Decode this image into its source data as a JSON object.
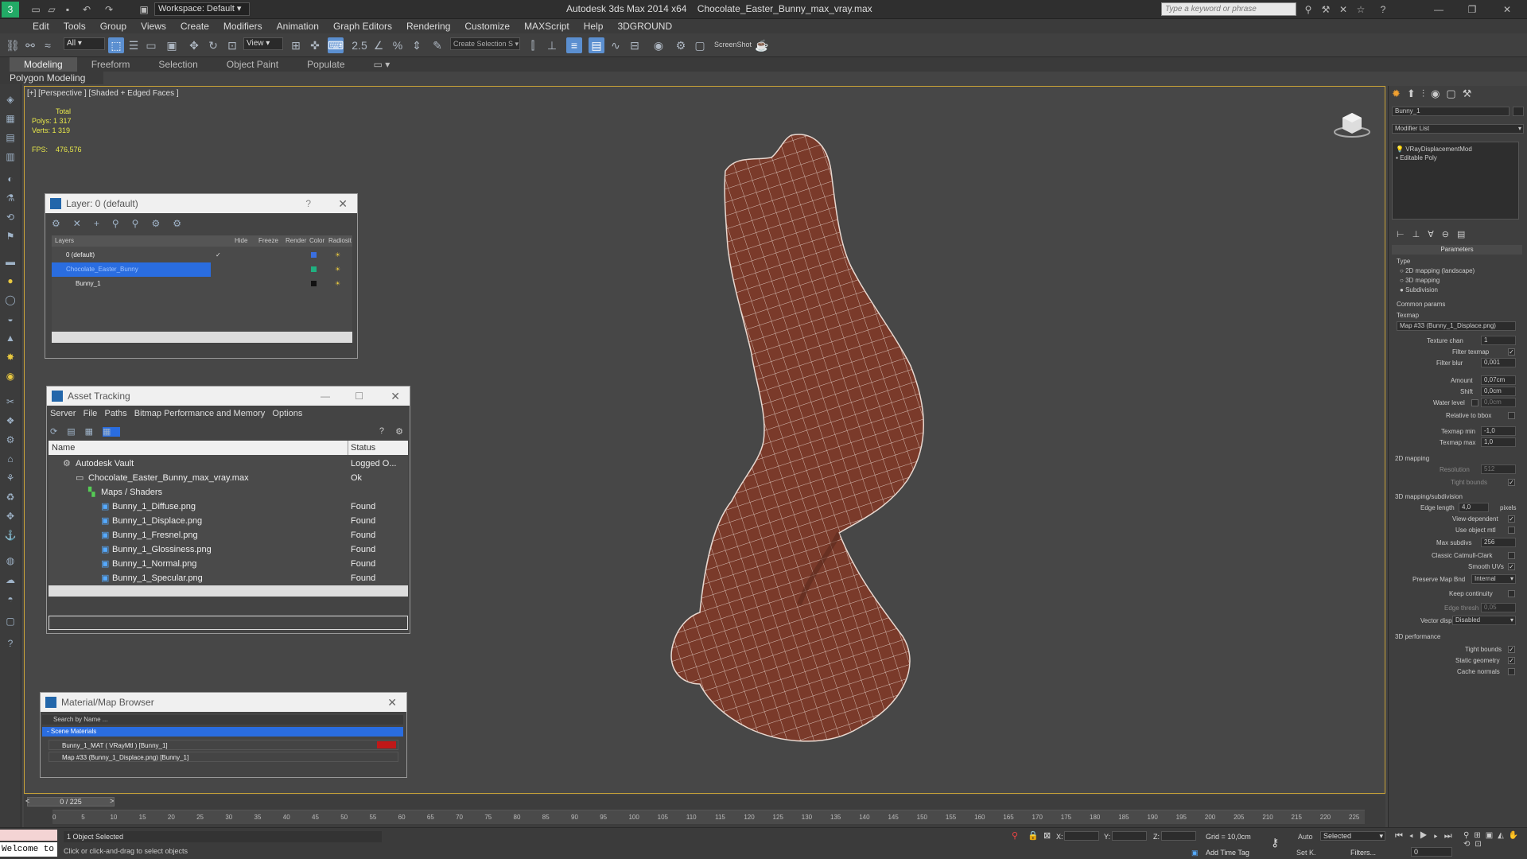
{
  "app": {
    "title": "Autodesk 3ds Max  2014 x64",
    "file": "Chocolate_Easter_Bunny_max_vray.max",
    "workspace": "Workspace: Default",
    "search_placeholder": "Type a keyword or phrase"
  },
  "menu": [
    "Edit",
    "Tools",
    "Group",
    "Views",
    "Create",
    "Modifiers",
    "Animation",
    "Graph Editors",
    "Rendering",
    "Customize",
    "MAXScript",
    "Help",
    "3DGROUND"
  ],
  "toolbar": {
    "filter": "All",
    "view": "View",
    "selection_set": "Create Selection S",
    "screenshot": "ScreenShot"
  },
  "ribbon": {
    "tabs": [
      "Modeling",
      "Freeform",
      "Selection",
      "Object Paint",
      "Populate"
    ],
    "sub": "Polygon Modeling"
  },
  "viewport": {
    "label": "[+] [Perspective ] [Shaded + Edged Faces ]",
    "stats_total": "Total",
    "polys_label": "Polys:",
    "polys": "1 317",
    "verts_label": "Verts:",
    "verts": "1 319",
    "fps_label": "FPS:",
    "fps": "476,576",
    "mesh_color": "#7a3a2a",
    "wire_color": "#e8d8d0"
  },
  "layer": {
    "title": "Layer: 0 (default)",
    "help": "?",
    "cols": [
      "Layers",
      "Hide",
      "Freeze",
      "Render",
      "Color",
      "Radiosit"
    ],
    "rows": [
      "0 (default)",
      "Chocolate_Easter_Bunny",
      "Bunny_1"
    ]
  },
  "asset": {
    "title": "Asset Tracking",
    "menu": [
      "Server",
      "File",
      "Paths",
      "Bitmap Performance and Memory",
      "Options"
    ],
    "cols": [
      "Name",
      "Status"
    ],
    "rows": [
      {
        "name": "Autodesk Vault",
        "status": "Logged O..."
      },
      {
        "name": "Chocolate_Easter_Bunny_max_vray.max",
        "status": "Ok"
      },
      {
        "name": "Maps / Shaders",
        "status": ""
      },
      {
        "name": "Bunny_1_Diffuse.png",
        "status": "Found"
      },
      {
        "name": "Bunny_1_Displace.png",
        "status": "Found"
      },
      {
        "name": "Bunny_1_Fresnel.png",
        "status": "Found"
      },
      {
        "name": "Bunny_1_Glossiness.png",
        "status": "Found"
      },
      {
        "name": "Bunny_1_Normal.png",
        "status": "Found"
      },
      {
        "name": "Bunny_1_Specular.png",
        "status": "Found"
      }
    ]
  },
  "matbrowser": {
    "title": "Material/Map Browser",
    "search": "Search by Name ...",
    "group": "- Scene Materials",
    "items": [
      "Bunny_1_MAT ( VRayMtl ) [Bunny_1]",
      "Map #33 (Bunny_1_Displace.png) [Bunny_1]"
    ]
  },
  "modify": {
    "object_name": "Bunny_1",
    "modifier_list": "Modifier List",
    "stack": [
      "VRayDisplacementMod",
      "Editable Poly"
    ],
    "rollout": "Parameters",
    "type_label": "Type",
    "types": [
      "2D mapping (landscape)",
      "3D mapping",
      "Subdivision"
    ],
    "common": "Common params",
    "texmap_label": "Texmap",
    "texmap": "Map #33 (Bunny_1_Displace.png)",
    "texture_chan_label": "Texture chan",
    "texture_chan": "1",
    "filter_texmap": "Filter texmap",
    "filter_blur_label": "Filter blur",
    "filter_blur": "0,001",
    "amount_label": "Amount",
    "amount": "0,07cm",
    "shift_label": "Shift",
    "shift": "0,0cm",
    "water_label": "Water level",
    "water": "0,0cm",
    "relative": "Relative to bbox",
    "texmap_min_label": "Texmap min",
    "texmap_min": "-1,0",
    "texmap_max_label": "Texmap max",
    "texmap_max": "1,0",
    "map2d": "2D mapping",
    "resolution_label": "Resolution",
    "resolution": "512",
    "tight_bounds": "Tight bounds",
    "map3d": "3D mapping/subdivision",
    "edge_length_label": "Edge length",
    "edge_length": "4,0",
    "pixels": "pixels",
    "view_dependent": "View-dependent",
    "use_object_mtl": "Use object mtl",
    "max_subdivs_label": "Max subdivs",
    "max_subdivs": "256",
    "catmull": "Classic Catmull-Clark",
    "smooth_uvs": "Smooth UVs",
    "preserve_label": "Preserve Map Bnd",
    "preserve": "Internal",
    "keep_continuity": "Keep continuity",
    "edge_thresh_label": "Edge thresh",
    "edge_thresh": "0,05",
    "vector_label": "Vector displ",
    "vector": "Disabled",
    "perf": "3D performance",
    "tight_bounds2": "Tight bounds",
    "static_geometry": "Static geometry",
    "cache_normals": "Cache normals"
  },
  "timeline": {
    "frame": "0 / 225",
    "ticks": [
      "0",
      "5",
      "10",
      "15",
      "20",
      "25",
      "30",
      "35",
      "40",
      "45",
      "50",
      "55",
      "60",
      "65",
      "70",
      "75",
      "80",
      "85",
      "90",
      "95",
      "100",
      "105",
      "110",
      "115",
      "120",
      "125",
      "130",
      "135",
      "140",
      "145",
      "150",
      "155",
      "160",
      "165",
      "170",
      "175",
      "180",
      "185",
      "190",
      "195",
      "200",
      "205",
      "210",
      "215",
      "220",
      "225"
    ]
  },
  "status": {
    "welcome": "Welcome to",
    "selected": "1 Object Selected",
    "hint": "Click or click-and-drag to select objects",
    "x": "X:",
    "y": "Y:",
    "z": "Z:",
    "grid": "Grid = 10,0cm",
    "auto": "Auto",
    "setk": "Set K.",
    "selected_dd": "Selected",
    "filters": "Filters...",
    "addtime": "Add Time Tag",
    "frame": "0"
  }
}
